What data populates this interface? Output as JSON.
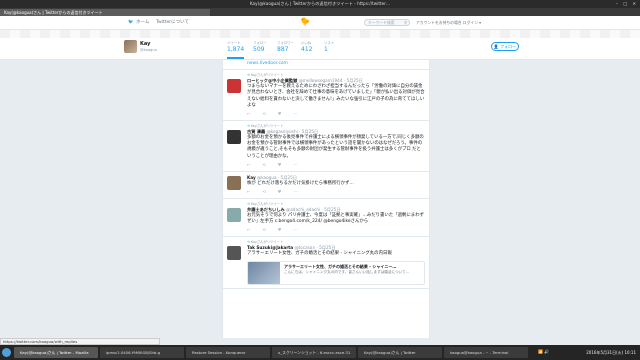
{
  "window": {
    "title": "Kay(@kaogua)さん | Twitterからの返信付きツイート - https://twitter…",
    "controls": [
      "–",
      "□",
      "✕"
    ]
  },
  "tabs": [
    {
      "label": "Kay(@kaogua)さん | Twitterからの返信付きツイート",
      "active": true
    }
  ],
  "nav": {
    "home": "ホーム",
    "about": "Twitterについて",
    "search_placeholder": "キーワード検索",
    "account_prompt": "アカウントをお持ちの場合 ログイン ▾"
  },
  "profile": {
    "name": "Kay",
    "handle": "@kaogua",
    "follow_label": "フォロー",
    "stats": [
      {
        "label": "ツイート",
        "value": "1,874",
        "active": true
      },
      {
        "label": "フォロー",
        "value": "509"
      },
      {
        "label": "フォロワー",
        "value": "887"
      },
      {
        "label": "いいね",
        "value": "412"
      },
      {
        "label": "リスト",
        "value": "1"
      }
    ]
  },
  "tweets": [
    {
      "rt_note": "",
      "name": "",
      "meta": "",
      "text": "news.livedoor.com",
      "avatar_color": "",
      "is_link_row": true
    },
    {
      "rt_note": "Kayさんがリツイート",
      "name": "ローヒック@中小企業監獄",
      "meta": "@mellowsegam1944 · 5月25日",
      "text": "つまらないマナーを教えるためにわざわざ担当するんだったら「労働の対価に自分の賃金が見合わないとき、会社を辞めて仕事の意味をあげていました」「親が払い出る対価が見合えない給料を貰わないと決して働きません!」みたいな強引に江戸の子の為に育ててほしいよな",
      "avatar_color": "#c33"
    },
    {
      "rt_note": "Kayさんがリツイート",
      "name": "古賀 清義",
      "meta": "@kogaseiyoshi · 5月25日",
      "text": "多額のお金を預かる後見事件で弁護士による横領事件が頻発している一方で,同じく多額のお金を預かる管財事件では横領事件があったという話を聞かないのはなぜだろう。事件の規模が違うこと,そもそも多額の財団が発生する管財事件を扱う弁護士は多くがプロ だということが理由かな。",
      "avatar_color": "#333"
    },
    {
      "rt_note": "",
      "name": "Kay",
      "meta": "@kaogua · 5月25日",
      "text": "株が どれだけ落ちるかだけ気掛けたら事務所行かず…",
      "avatar_color": "#8a6f57"
    },
    {
      "rt_note": "Kayさんがリツイート",
      "name": "弁護士あだちいしみ",
      "meta": "@adachi_adachi · 5月25日",
      "text": "お元気そうで何より パリ弁護士、今度は「証拠と事実確」…みだり書いた「過剰にまわずぜい」左手方 c.bengo4.com/k_224/ @bengo4ikeさんから",
      "avatar_color": "#8aa"
    },
    {
      "rt_note": "Kayさんがリツイート",
      "name": "Tak Suzuki@Jakarta",
      "meta": "@tocasan · 5月25日",
      "text": "アラサーエリート女性、ガチの婚活とその結果 - シャイニング丸の内日報",
      "avatar_color": "#555",
      "card_title": "アラサーエリート女性、ガチの婚活とその結果 - シャイニー…",
      "card_desc": "こんにちは、シャイニング丸の内です。皆さんいい話しまずは婚活について…"
    }
  ],
  "tweet_actions": [
    "↩",
    "⟲",
    "♥",
    "···"
  ],
  "status_url": "https://twitter.com/kaogua/with_replies",
  "taskbar": {
    "items": [
      {
        "label": "Kay(@kaogua)さん | Twitter - Mozilla",
        "active": true
      },
      {
        "label": "ipmsc2.0406-f9MI0G8/Shb-g",
        "active": false
      },
      {
        "label": "Restore Session - Konqueror",
        "active": false
      },
      {
        "label": "x_スクリーンショット - 6.esccc-esce.31",
        "active": false
      },
      {
        "label": "Kay(@kaogua)さん | Twitter",
        "active": false
      },
      {
        "label": "kaogua@kaogua - ~ - Terminal",
        "active": false
      }
    ],
    "clock": "2016年5月31日(火) 10:11"
  }
}
